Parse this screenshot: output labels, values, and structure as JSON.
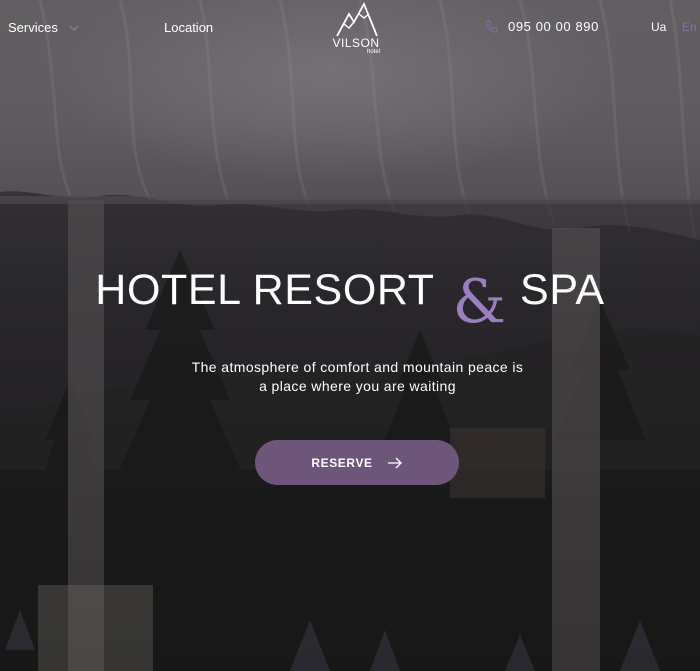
{
  "header": {
    "services_label": "Services",
    "location_label": "Location",
    "logo": {
      "name": "VILSON",
      "sub": "hotel"
    },
    "phone": "095 00 00 890",
    "languages": [
      {
        "code": "Ua",
        "active": false
      },
      {
        "code": "En",
        "active": true
      }
    ]
  },
  "hero": {
    "title_part1": "HOTEL RESORT",
    "ampersand": "&",
    "title_part2": "SPA",
    "subtitle_line1": "The atmosphere of comfort and mountain peace is",
    "subtitle_line2": "a place where you are waiting",
    "reserve_label": "RESERVE"
  },
  "colors": {
    "accent": "#9a7fbf",
    "button": "#6d5679",
    "active_language": "#8b6fa3",
    "text": "#ffffff"
  },
  "icons": {
    "services_dropdown": "chevron-down-icon",
    "phone": "phone-icon",
    "reserve": "arrow-right-icon",
    "logo": "mountain-logo-icon"
  }
}
